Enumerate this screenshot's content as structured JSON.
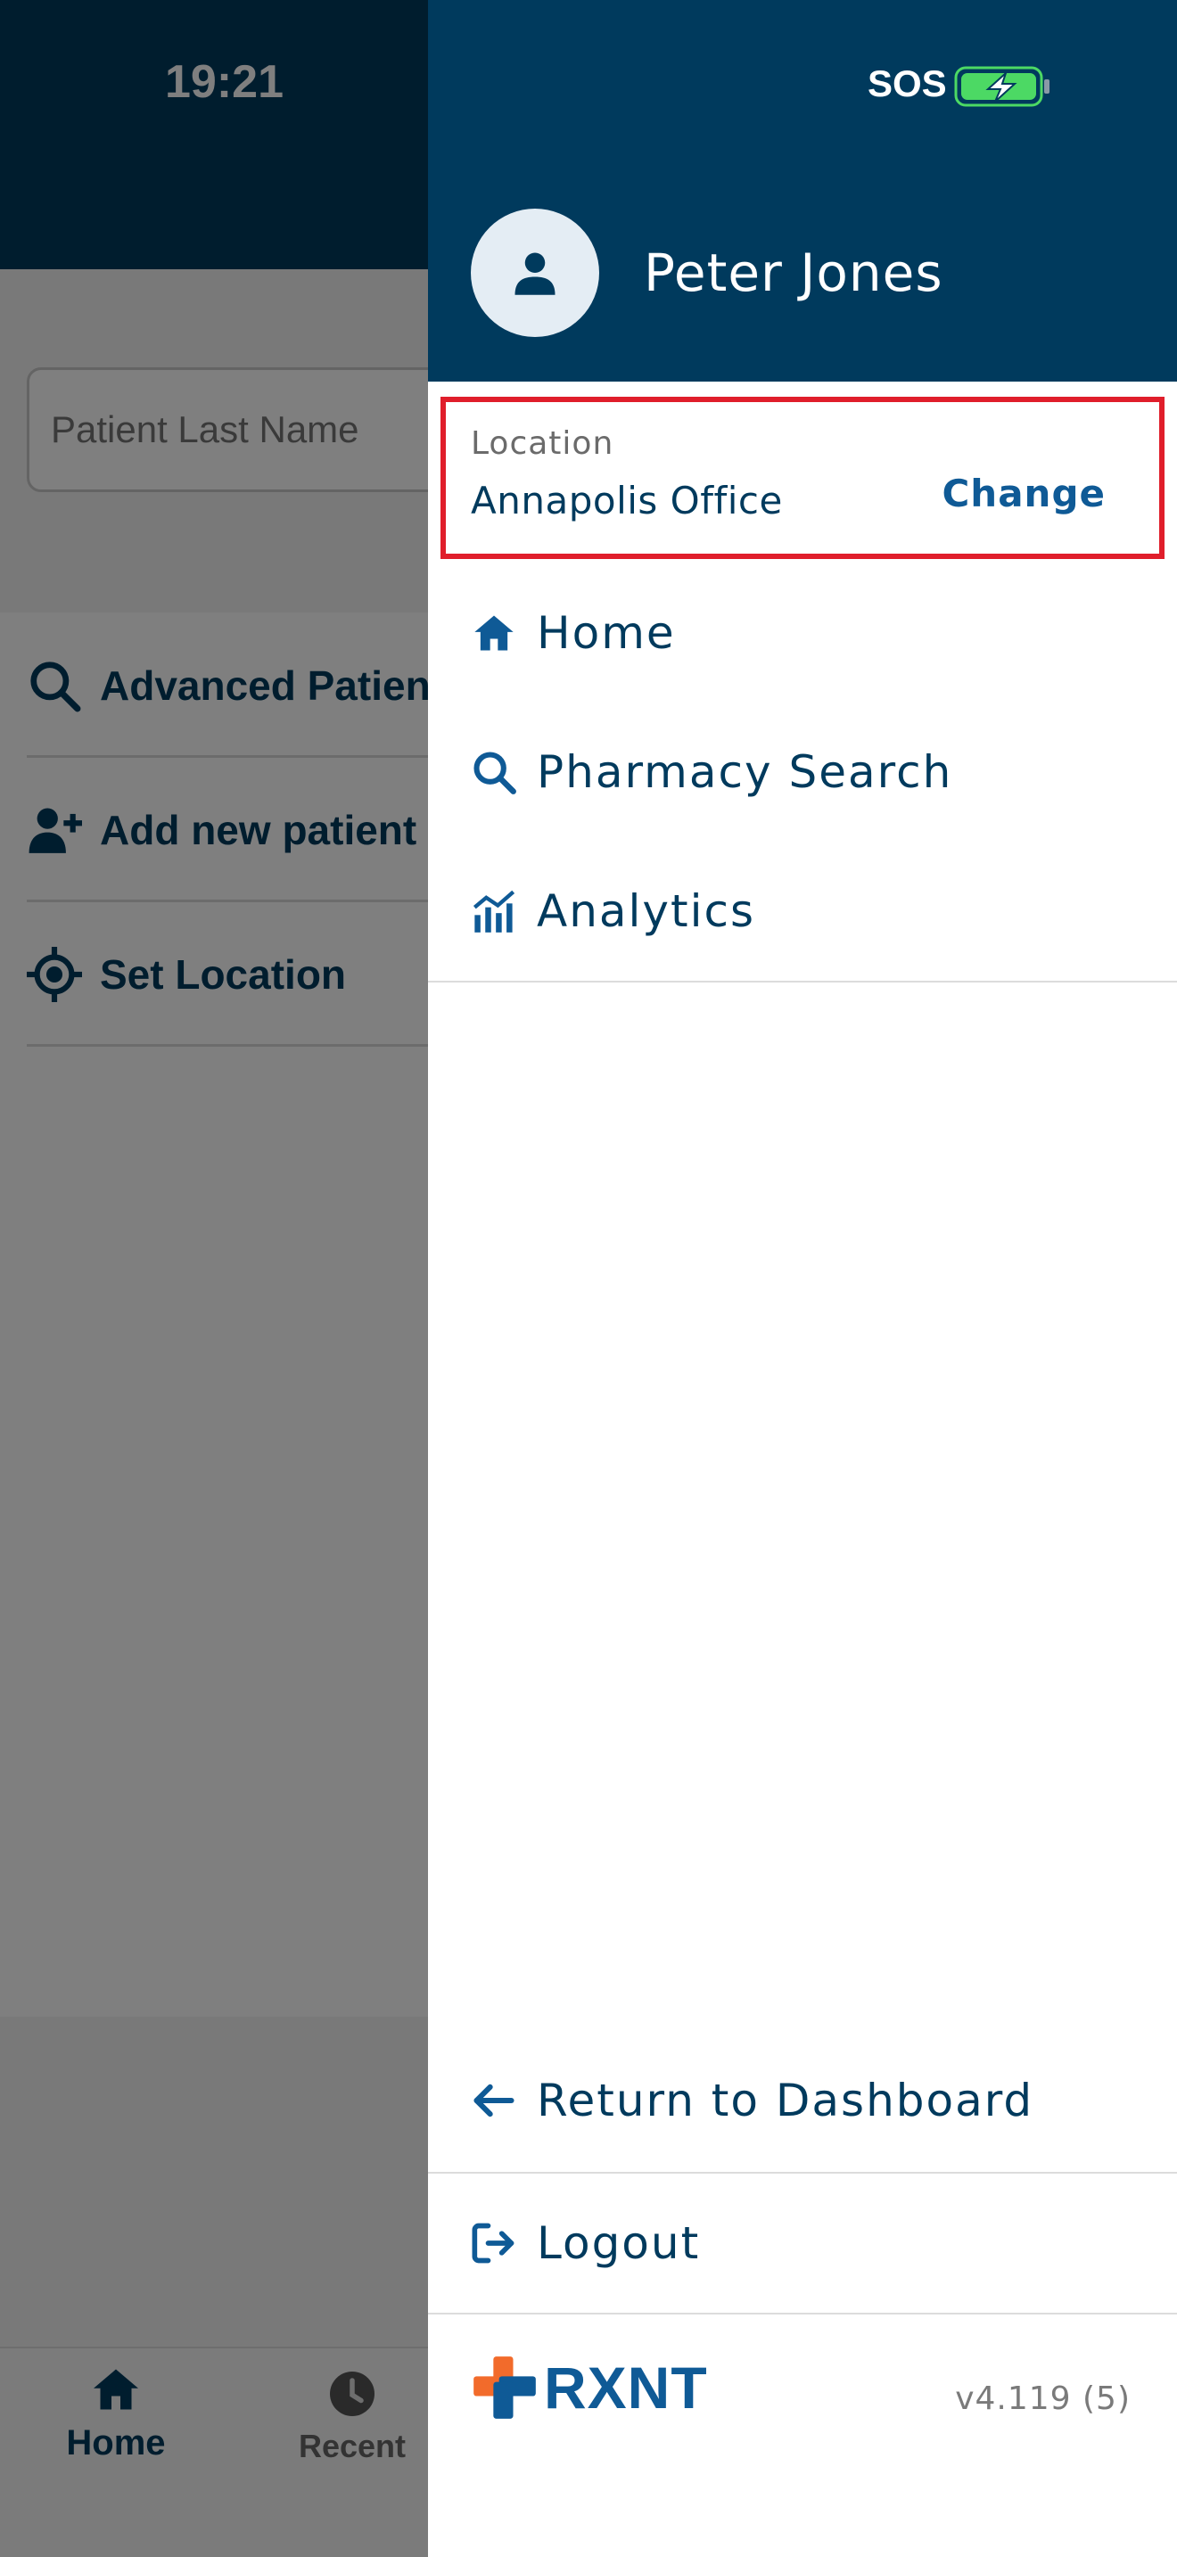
{
  "status_bar": {
    "time": "19:21",
    "carrier": "SOS"
  },
  "background": {
    "search": {
      "placeholder": "Patient Last Name"
    },
    "actions": [
      {
        "label": "Advanced Patient Search",
        "icon": "search-icon"
      },
      {
        "label": "Add new patient",
        "icon": "add-user-icon"
      },
      {
        "label": "Set Location",
        "icon": "crosshair-icon"
      }
    ],
    "tabbar": [
      {
        "label": "Home",
        "icon": "home-icon",
        "active": true
      },
      {
        "label": "Recent",
        "icon": "clock-icon",
        "active": false
      }
    ]
  },
  "drawer": {
    "user": {
      "name": "Peter Jones"
    },
    "location": {
      "label": "Location",
      "value": "Annapolis Office",
      "action": "Change"
    },
    "menu": [
      {
        "label": "Home",
        "icon": "home-icon"
      },
      {
        "label": "Pharmacy Search",
        "icon": "search-icon"
      },
      {
        "label": "Analytics",
        "icon": "analytics-icon"
      }
    ],
    "footer_menu": [
      {
        "label": "Return to Dashboard",
        "icon": "arrow-left-icon"
      },
      {
        "label": "Logout",
        "icon": "logout-icon"
      }
    ],
    "brand": {
      "name": "RXNT"
    },
    "version": "v4.119 (5)"
  },
  "colors": {
    "primary": "#003a5d",
    "accent": "#0f5a96",
    "highlight": "#e01e2b",
    "brand_orange": "#f26b2b"
  }
}
